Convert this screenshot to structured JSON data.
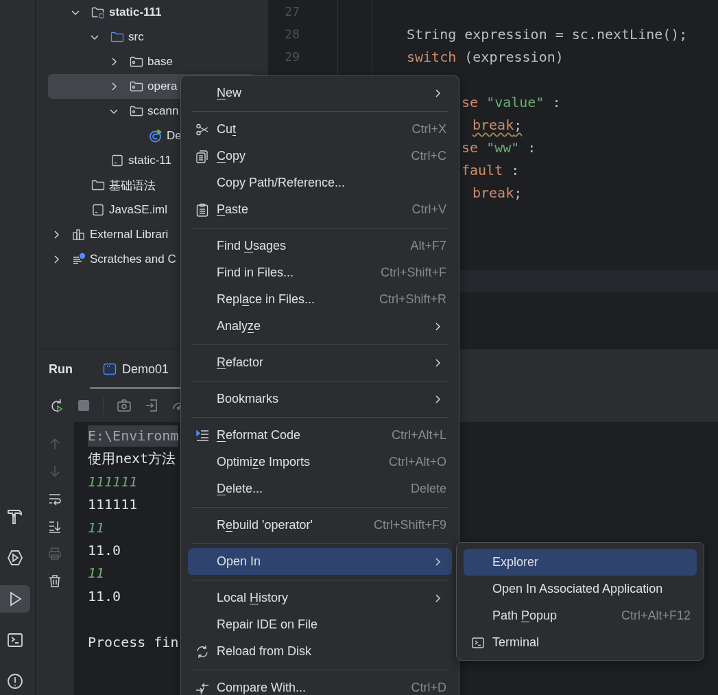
{
  "toolwindow_strip": [
    {
      "kind": "build",
      "selected": false
    },
    {
      "kind": "services",
      "selected": false
    },
    {
      "kind": "run",
      "selected": true
    },
    {
      "kind": "terminal",
      "selected": false
    },
    {
      "kind": "problems",
      "selected": false
    }
  ],
  "project_tree": [
    {
      "kind": "offscreen",
      "children": [
        {
          "label": "static-111",
          "kind": "module",
          "expanded": true,
          "selected": false,
          "children": [
            {
              "label": "src",
              "kind": "source",
              "expanded": true,
              "selected": false,
              "children": [
                {
                  "label": "base",
                  "kind": "package",
                  "expanded": false,
                  "selected": false
                },
                {
                  "label": "opera",
                  "kind": "package",
                  "expanded": false,
                  "selected": true
                },
                {
                  "label": "scann",
                  "kind": "package",
                  "expanded": true,
                  "selected": false,
                  "children": [
                    {
                      "label": "De",
                      "kind": "class",
                      "selected": false
                    }
                  ]
                }
              ]
            },
            {
              "label": "static-11",
              "kind": "file",
              "selected": false
            }
          ]
        },
        {
          "label": "基础语法",
          "kind": "folder",
          "selected": false
        },
        {
          "label": "JavaSE.iml",
          "kind": "file",
          "selected": false
        }
      ]
    },
    {
      "label": "External Librari",
      "kind": "libraries",
      "expanded": false,
      "selected": false
    },
    {
      "label": "Scratches and C",
      "kind": "scratches",
      "expanded": false,
      "selected": false
    }
  ],
  "editor": {
    "line_numbers": [
      "27",
      "28",
      "29"
    ],
    "lines": [
      {
        "kind": "blank"
      },
      {
        "kind": "statement",
        "warning": false,
        "tokens": [
          {
            "text": "String expression = sc.nextLine();",
            "kind": "plain"
          }
        ]
      },
      {
        "kind": "statement",
        "warning": false,
        "tokens": [
          {
            "text": "switch",
            "kind": "keyword"
          },
          {
            "text": " (expression)",
            "kind": "plain"
          }
        ]
      },
      {
        "kind": "blank"
      },
      {
        "kind": "clipped",
        "warning": false,
        "tokens": [
          {
            "text": "se",
            "kind": "keyword"
          },
          {
            "text": " \"value\"",
            "kind": "string"
          },
          {
            "text": " :",
            "kind": "plain"
          }
        ]
      },
      {
        "kind": "nested",
        "warning": true,
        "tokens": [
          {
            "text": "break",
            "kind": "keyword"
          },
          {
            "text": ";",
            "kind": "plain"
          }
        ]
      },
      {
        "kind": "clipped",
        "warning": false,
        "tokens": [
          {
            "text": "se",
            "kind": "keyword"
          },
          {
            "text": " \"ww\"",
            "kind": "string"
          },
          {
            "text": " :",
            "kind": "plain"
          }
        ]
      },
      {
        "kind": "clipped",
        "warning": false,
        "tokens": [
          {
            "text": "fault",
            "kind": "keyword"
          },
          {
            "text": " :",
            "kind": "plain"
          }
        ]
      },
      {
        "kind": "nested",
        "warning": false,
        "tokens": [
          {
            "text": "break",
            "kind": "keyword"
          },
          {
            "text": ";",
            "kind": "plain"
          }
        ]
      }
    ]
  },
  "run_panel": {
    "title": "Run",
    "tabs": [
      {
        "label": "Demo01",
        "selected": true
      }
    ],
    "toolbar": [
      {
        "kind": "rerun"
      },
      {
        "kind": "stop"
      },
      {
        "kind": "separator"
      },
      {
        "kind": "screenshot"
      },
      {
        "kind": "attach"
      },
      {
        "kind": "profile"
      }
    ],
    "console_actions": [
      {
        "kind": "up",
        "disabled": true
      },
      {
        "kind": "down",
        "disabled": true
      },
      {
        "kind": "wrap",
        "disabled": false
      },
      {
        "kind": "scroll-end",
        "disabled": false
      },
      {
        "kind": "print",
        "disabled": true
      },
      {
        "kind": "clear",
        "disabled": false
      }
    ],
    "console": [
      {
        "text": "E:\\Environm",
        "kind": "command"
      },
      {
        "text": "使用next方法",
        "kind": "output"
      },
      {
        "text": "111111",
        "kind": "input"
      },
      {
        "text": "111111",
        "kind": "output"
      },
      {
        "text": "11",
        "kind": "input"
      },
      {
        "text": "11.0",
        "kind": "output"
      },
      {
        "text": "11",
        "kind": "input"
      },
      {
        "text": "11.0",
        "kind": "output"
      },
      {
        "kind": "blank"
      },
      {
        "text": "Process fin",
        "kind": "output"
      }
    ]
  },
  "context_menu": {
    "items": [
      {
        "kind": "plain",
        "submenu": true,
        "selected": false,
        "parts": [
          {
            "text": "N",
            "underline": true
          },
          {
            "text": "ew",
            "underline": false
          }
        ]
      },
      {
        "kind": "separator"
      },
      {
        "kind": "cut",
        "submenu": false,
        "selected": false,
        "shortcut": "Ctrl+X",
        "parts": [
          {
            "text": "Cu",
            "underline": false
          },
          {
            "text": "t",
            "underline": true
          }
        ]
      },
      {
        "kind": "copy",
        "submenu": false,
        "selected": false,
        "shortcut": "Ctrl+C",
        "parts": [
          {
            "text": "C",
            "underline": true
          },
          {
            "text": "opy",
            "underline": false
          }
        ]
      },
      {
        "kind": "plain",
        "submenu": false,
        "selected": false,
        "parts": [
          {
            "text": "Copy Path/Reference...",
            "underline": false
          }
        ]
      },
      {
        "kind": "paste",
        "submenu": false,
        "selected": false,
        "shortcut": "Ctrl+V",
        "parts": [
          {
            "text": "P",
            "underline": true
          },
          {
            "text": "aste",
            "underline": false
          }
        ]
      },
      {
        "kind": "separator"
      },
      {
        "kind": "plain",
        "submenu": false,
        "selected": false,
        "shortcut": "Alt+F7",
        "parts": [
          {
            "text": "Find ",
            "underline": false
          },
          {
            "text": "U",
            "underline": true
          },
          {
            "text": "sages",
            "underline": false
          }
        ]
      },
      {
        "kind": "plain",
        "submenu": false,
        "selected": false,
        "shortcut": "Ctrl+Shift+F",
        "parts": [
          {
            "text": "Find in Files...",
            "underline": false
          }
        ]
      },
      {
        "kind": "plain",
        "submenu": false,
        "selected": false,
        "shortcut": "Ctrl+Shift+R",
        "parts": [
          {
            "text": "Repl",
            "underline": false
          },
          {
            "text": "a",
            "underline": true
          },
          {
            "text": "ce in Files...",
            "underline": false
          }
        ]
      },
      {
        "kind": "plain",
        "submenu": true,
        "selected": false,
        "parts": [
          {
            "text": "Analy",
            "underline": false
          },
          {
            "text": "z",
            "underline": true
          },
          {
            "text": "e",
            "underline": false
          }
        ]
      },
      {
        "kind": "separator"
      },
      {
        "kind": "plain",
        "submenu": true,
        "selected": false,
        "parts": [
          {
            "text": "R",
            "underline": true
          },
          {
            "text": "efactor",
            "underline": false
          }
        ]
      },
      {
        "kind": "separator"
      },
      {
        "kind": "plain",
        "submenu": true,
        "selected": false,
        "parts": [
          {
            "text": "Bookmarks",
            "underline": false
          }
        ]
      },
      {
        "kind": "separator"
      },
      {
        "kind": "reformat",
        "submenu": false,
        "selected": false,
        "shortcut": "Ctrl+Alt+L",
        "parts": [
          {
            "text": "R",
            "underline": true
          },
          {
            "text": "eformat Code",
            "underline": false
          }
        ]
      },
      {
        "kind": "plain",
        "submenu": false,
        "selected": false,
        "shortcut": "Ctrl+Alt+O",
        "parts": [
          {
            "text": "Optimi",
            "underline": false
          },
          {
            "text": "z",
            "underline": true
          },
          {
            "text": "e Imports",
            "underline": false
          }
        ]
      },
      {
        "kind": "plain",
        "submenu": false,
        "selected": false,
        "shortcut": "Delete",
        "parts": [
          {
            "text": "D",
            "underline": true
          },
          {
            "text": "elete...",
            "underline": false
          }
        ]
      },
      {
        "kind": "separator"
      },
      {
        "kind": "plain",
        "submenu": false,
        "selected": false,
        "shortcut": "Ctrl+Shift+F9",
        "parts": [
          {
            "text": "R",
            "underline": false
          },
          {
            "text": "e",
            "underline": true
          },
          {
            "text": "build 'operator'",
            "underline": false
          }
        ]
      },
      {
        "kind": "separator"
      },
      {
        "kind": "plain",
        "submenu": true,
        "selected": true,
        "parts": [
          {
            "text": "Open In",
            "underline": false
          }
        ]
      },
      {
        "kind": "separator"
      },
      {
        "kind": "plain",
        "submenu": true,
        "selected": false,
        "parts": [
          {
            "text": "Local ",
            "underline": false
          },
          {
            "text": "H",
            "underline": true
          },
          {
            "text": "istory",
            "underline": false
          }
        ]
      },
      {
        "kind": "plain",
        "submenu": false,
        "selected": false,
        "parts": [
          {
            "text": "Repair IDE on File",
            "underline": false
          }
        ]
      },
      {
        "kind": "reload",
        "submenu": false,
        "selected": false,
        "parts": [
          {
            "text": "Reload from Disk",
            "underline": false
          }
        ]
      },
      {
        "kind": "separator"
      },
      {
        "kind": "compare",
        "submenu": false,
        "selected": false,
        "shortcut": "Ctrl+D",
        "parts": [
          {
            "text": "Compare With...",
            "underline": false
          }
        ]
      }
    ]
  },
  "submenu": {
    "items": [
      {
        "kind": "plain",
        "selected": true,
        "parts": [
          {
            "text": "Explorer",
            "underline": false
          }
        ]
      },
      {
        "kind": "plain",
        "selected": false,
        "parts": [
          {
            "text": "Open In Associated Application",
            "underline": false
          }
        ]
      },
      {
        "kind": "plain",
        "selected": false,
        "shortcut": "Ctrl+Alt+F12",
        "parts": [
          {
            "text": "Path ",
            "underline": false
          },
          {
            "text": "P",
            "underline": true
          },
          {
            "text": "opup",
            "underline": false
          }
        ]
      },
      {
        "kind": "terminal",
        "selected": false,
        "parts": [
          {
            "text": "Terminal",
            "underline": false
          }
        ]
      }
    ]
  }
}
